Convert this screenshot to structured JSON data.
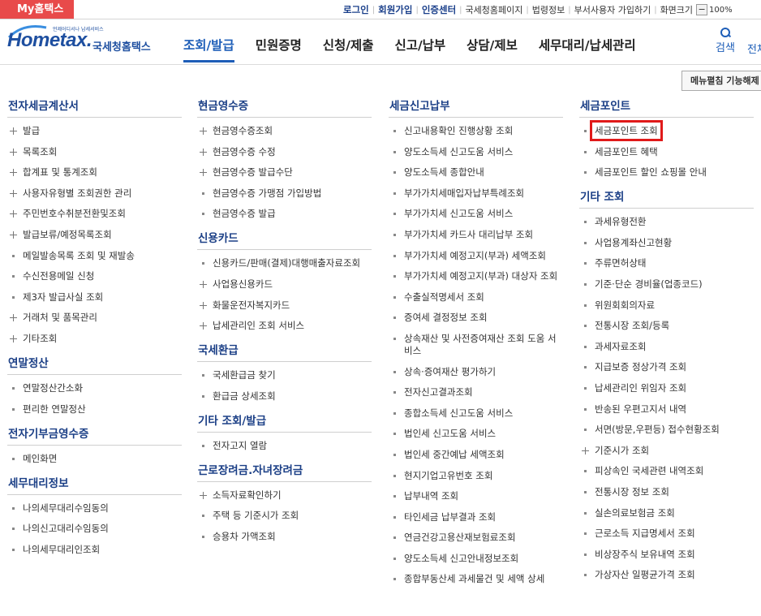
{
  "topbar": {
    "brand": "My홈택스",
    "links": [
      {
        "label": "로그인",
        "main": true
      },
      {
        "label": "회원가입",
        "main": true
      },
      {
        "label": "인증센터",
        "main": true
      },
      {
        "label": "국세청홈페이지",
        "main": false
      },
      {
        "label": "법령정보",
        "main": false
      },
      {
        "label": "부서사용자 가입하기",
        "main": false
      },
      {
        "label": "화면크기",
        "main": false
      }
    ],
    "zoom_minus": "−",
    "zoom_level": "100%"
  },
  "header": {
    "logo_tagline": "언제어디서나 납세서비스",
    "logo_text": "Hometax.",
    "logo_ko": "국세청홈택스",
    "gnb": [
      {
        "label": "조회/발급",
        "active": true
      },
      {
        "label": "민원증명",
        "active": false
      },
      {
        "label": "신청/제출",
        "active": false
      },
      {
        "label": "신고/납부",
        "active": false
      },
      {
        "label": "상담/제보",
        "active": false
      },
      {
        "label": "세무대리/납세관리",
        "active": false
      }
    ],
    "search_label": "검색",
    "all_menu_label": "전체"
  },
  "menu_close_label": "메뉴펼침 기능해제",
  "columns": [
    {
      "sections": [
        {
          "title": "전자세금계산서",
          "items": [
            {
              "label": "발급",
              "marker": "plus"
            },
            {
              "label": "목록조회",
              "marker": "plus"
            },
            {
              "label": "합계표 및 통계조회",
              "marker": "plus"
            },
            {
              "label": "사용자유형별 조회권한 관리",
              "marker": "plus"
            },
            {
              "label": "주민번호수취분전환및조회",
              "marker": "plus"
            },
            {
              "label": "발급보류/예정목록조회",
              "marker": "plus"
            },
            {
              "label": "메일발송목록 조회 및 재발송",
              "marker": "dot"
            },
            {
              "label": "수신전용메일 신청",
              "marker": "dot"
            },
            {
              "label": "제3자 발급사실 조회",
              "marker": "dot"
            },
            {
              "label": "거래처 및 품목관리",
              "marker": "plus"
            },
            {
              "label": "기타조회",
              "marker": "plus"
            }
          ]
        },
        {
          "title": "연말정산",
          "items": [
            {
              "label": "연말정산간소화",
              "marker": "dot"
            },
            {
              "label": "편리한 연말정산",
              "marker": "dot"
            }
          ]
        },
        {
          "title": "전자기부금영수증",
          "items": [
            {
              "label": "메인화면",
              "marker": "dot"
            }
          ]
        },
        {
          "title": "세무대리정보",
          "items": [
            {
              "label": "나의세무대리수임동의",
              "marker": "dot"
            },
            {
              "label": "나의신고대리수임동의",
              "marker": "dot"
            },
            {
              "label": "나의세무대리인조회",
              "marker": "dot"
            }
          ]
        }
      ]
    },
    {
      "sections": [
        {
          "title": "현금영수증",
          "items": [
            {
              "label": "현금영수증조회",
              "marker": "plus"
            },
            {
              "label": "현금영수증 수정",
              "marker": "plus"
            },
            {
              "label": "현금영수증 발급수단",
              "marker": "plus"
            },
            {
              "label": "현금영수증 가맹점 가입방법",
              "marker": "dot"
            },
            {
              "label": "현금영수증 발급",
              "marker": "dot"
            }
          ]
        },
        {
          "title": "신용카드",
          "items": [
            {
              "label": "신용카드/판매(결제)대행매출자료조회",
              "marker": "dot"
            },
            {
              "label": "사업용신용카드",
              "marker": "plus"
            },
            {
              "label": "화물운전자복지카드",
              "marker": "plus"
            },
            {
              "label": "납세관리인 조회 서비스",
              "marker": "plus"
            }
          ]
        },
        {
          "title": "국세환급",
          "items": [
            {
              "label": "국세환급금 찾기",
              "marker": "dot"
            },
            {
              "label": "환급금 상세조회",
              "marker": "dot"
            }
          ]
        },
        {
          "title": "기타 조회/발급",
          "items": [
            {
              "label": "전자고지 열람",
              "marker": "dot"
            }
          ]
        },
        {
          "title": "근로장려금.자녀장려금",
          "items": [
            {
              "label": "소득자료확인하기",
              "marker": "plus"
            },
            {
              "label": "주택 등 기준시가 조회",
              "marker": "dot"
            },
            {
              "label": "승용차 가액조회",
              "marker": "dot"
            }
          ]
        }
      ]
    },
    {
      "sections": [
        {
          "title": "세금신고납부",
          "items": [
            {
              "label": "신고내용확인 진행상황 조회",
              "marker": "dot"
            },
            {
              "label": "양도소득세 신고도움 서비스",
              "marker": "dot"
            },
            {
              "label": "양도소득세 종합안내",
              "marker": "dot"
            },
            {
              "label": "부가가치세매입자납부특례조회",
              "marker": "dot"
            },
            {
              "label": "부가가치세 신고도움 서비스",
              "marker": "dot"
            },
            {
              "label": "부가가치세 카드사 대리납부 조회",
              "marker": "dot"
            },
            {
              "label": "부가가치세 예정고지(부과) 세액조회",
              "marker": "dot"
            },
            {
              "label": "부가가치세 예정고지(부과) 대상자 조회",
              "marker": "dot"
            },
            {
              "label": "수출실적명세서 조회",
              "marker": "dot"
            },
            {
              "label": "증여세 결정정보 조회",
              "marker": "dot"
            },
            {
              "label": "상속재산 및 사전증여재산 조회 도움 서비스",
              "marker": "dot"
            },
            {
              "label": "상속·증여재산 평가하기",
              "marker": "dot"
            },
            {
              "label": "전자신고결과조회",
              "marker": "dot"
            },
            {
              "label": "종합소득세 신고도움 서비스",
              "marker": "dot"
            },
            {
              "label": "법인세 신고도움 서비스",
              "marker": "dot"
            },
            {
              "label": "법인세 중간예납 세액조회",
              "marker": "dot"
            },
            {
              "label": "현지기업고유번호 조회",
              "marker": "dot"
            },
            {
              "label": "납부내역 조회",
              "marker": "dot"
            },
            {
              "label": "타인세금 납부결과 조회",
              "marker": "dot"
            },
            {
              "label": "연금건강고용산재보험료조회",
              "marker": "dot"
            },
            {
              "label": "양도소득세 신고안내정보조회",
              "marker": "dot"
            },
            {
              "label": "종합부동산세 과세물건 및 세액 상세",
              "marker": "dot"
            }
          ]
        }
      ]
    },
    {
      "sections": [
        {
          "title": "세금포인트",
          "items": [
            {
              "label": "세금포인트 조회",
              "marker": "dot",
              "highlight": true
            },
            {
              "label": "세금포인트 혜택",
              "marker": "dot"
            },
            {
              "label": "세금포인트 할인 쇼핑몰 안내",
              "marker": "dot"
            }
          ]
        },
        {
          "title": "기타 조회",
          "items": [
            {
              "label": "과세유형전환",
              "marker": "dot"
            },
            {
              "label": "사업용계좌신고현황",
              "marker": "dot"
            },
            {
              "label": "주류면허상태",
              "marker": "dot"
            },
            {
              "label": "기준·단순 경비율(업종코드)",
              "marker": "dot"
            },
            {
              "label": "위원회회의자료",
              "marker": "dot"
            },
            {
              "label": "전통시장 조회/등록",
              "marker": "dot"
            },
            {
              "label": "과세자료조회",
              "marker": "dot"
            },
            {
              "label": "지급보증 정상가격 조회",
              "marker": "dot"
            },
            {
              "label": "납세관리인 위임자 조회",
              "marker": "dot"
            },
            {
              "label": "반송된 우편고지서 내역",
              "marker": "dot"
            },
            {
              "label": "서면(방문,우편등) 접수현황조회",
              "marker": "dot"
            },
            {
              "label": "기준시가 조회",
              "marker": "plus"
            },
            {
              "label": "피상속인 국세관련 내역조회",
              "marker": "dot"
            },
            {
              "label": "전통시장 정보 조회",
              "marker": "dot"
            },
            {
              "label": "실손의료보험금 조회",
              "marker": "dot"
            },
            {
              "label": "근로소득 지급명세서 조회",
              "marker": "dot"
            },
            {
              "label": "비상장주식 보유내역 조회",
              "marker": "dot"
            },
            {
              "label": "가상자산 일평균가격 조회",
              "marker": "dot"
            }
          ]
        }
      ]
    }
  ]
}
